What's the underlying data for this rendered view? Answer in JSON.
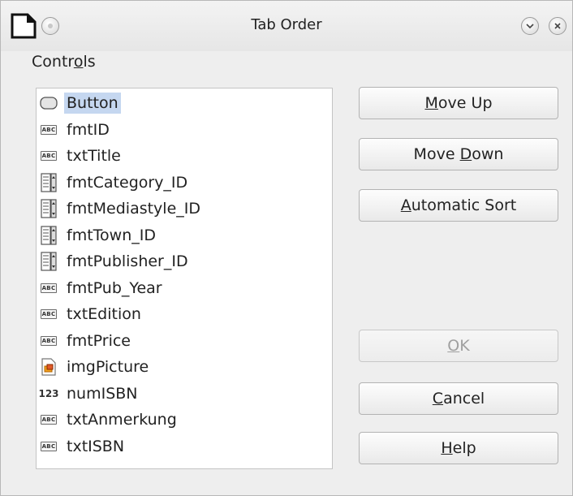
{
  "window": {
    "title": "Tab Order",
    "app_icon": "document-icon",
    "title_buttons": [
      "menu-icon",
      "minimize-icon",
      "close-icon"
    ]
  },
  "controls_label": "Controls",
  "controls": [
    {
      "label": "Button",
      "icon": "button-icon",
      "selected": true
    },
    {
      "label": "fmtID",
      "icon": "text-field-icon"
    },
    {
      "label": "txtTitle",
      "icon": "text-field-icon"
    },
    {
      "label": "fmtCategory_ID",
      "icon": "listbox-icon"
    },
    {
      "label": "fmtMediastyle_ID",
      "icon": "listbox-icon"
    },
    {
      "label": "fmtTown_ID",
      "icon": "listbox-icon"
    },
    {
      "label": "fmtPublisher_ID",
      "icon": "listbox-icon"
    },
    {
      "label": "fmtPub_Year",
      "icon": "text-field-icon"
    },
    {
      "label": "txtEdition",
      "icon": "text-field-icon"
    },
    {
      "label": "fmtPrice",
      "icon": "text-field-icon"
    },
    {
      "label": "imgPicture",
      "icon": "image-icon"
    },
    {
      "label": "numISBN",
      "icon": "numeric-field-icon"
    },
    {
      "label": "txtAnmerkung",
      "icon": "text-field-icon"
    },
    {
      "label": "txtISBN",
      "icon": "text-field-icon"
    }
  ],
  "icon_text": {
    "text_field": "ABC",
    "numeric": "123"
  },
  "buttons": {
    "move_up": "Move Up",
    "move_down": "Move Down",
    "automatic_sort": "Automatic Sort",
    "ok": "OK",
    "cancel": "Cancel",
    "help": "Help"
  },
  "colors": {
    "selection": "#c5d7f0",
    "window_bg": "#eeeeee"
  }
}
